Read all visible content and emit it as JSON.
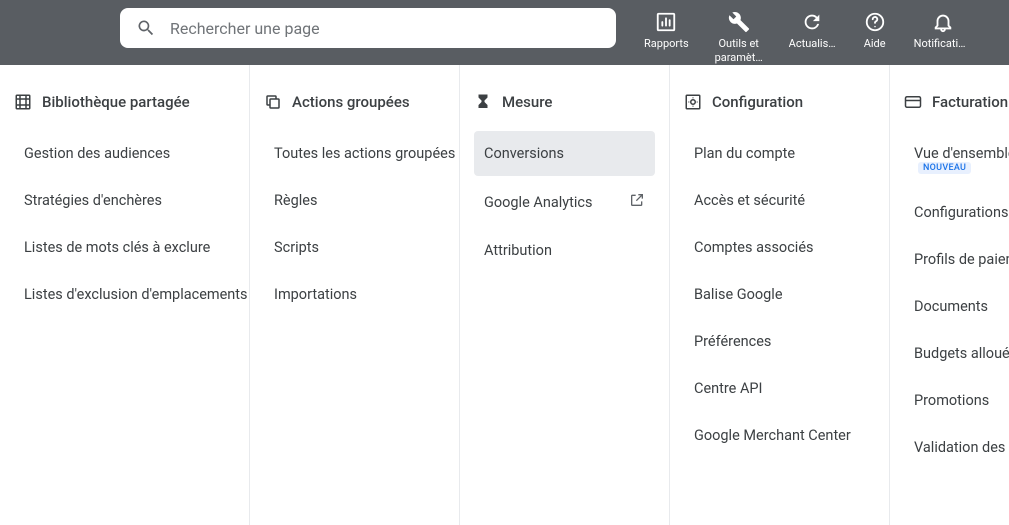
{
  "search": {
    "placeholder": "Rechercher une page"
  },
  "toolbar": {
    "reports": "Rapports",
    "tools": "Outils et paramèt…",
    "refresh": "Actualis…",
    "help": "Aide",
    "notifications": "Notifications"
  },
  "columns": [
    {
      "name": "shared-library",
      "title": "Bibliothèque partagée",
      "items": [
        {
          "label": "Gestion des audiences",
          "name": "audience-management"
        },
        {
          "label": "Stratégies d'enchères",
          "name": "bid-strategies"
        },
        {
          "label": "Listes de mots clés à exclure",
          "name": "negative-keyword-lists"
        },
        {
          "label": "Listes d'exclusion d'emplacements",
          "name": "placement-exclusion-lists"
        }
      ]
    },
    {
      "name": "bulk-actions",
      "title": "Actions groupées",
      "items": [
        {
          "label": "Toutes les actions groupées",
          "name": "all-bulk-actions"
        },
        {
          "label": "Règles",
          "name": "rules"
        },
        {
          "label": "Scripts",
          "name": "scripts"
        },
        {
          "label": "Importations",
          "name": "uploads"
        }
      ]
    },
    {
      "name": "measure",
      "title": "Mesure",
      "items": [
        {
          "label": "Conversions",
          "name": "conversions",
          "highlight": true
        },
        {
          "label": "Google Analytics",
          "name": "google-analytics",
          "external": true
        },
        {
          "label": "Attribution",
          "name": "attribution"
        }
      ]
    },
    {
      "name": "configuration",
      "title": "Configuration",
      "items": [
        {
          "label": "Plan du compte",
          "name": "account-map"
        },
        {
          "label": "Accès et sécurité",
          "name": "access-security"
        },
        {
          "label": "Comptes associés",
          "name": "linked-accounts"
        },
        {
          "label": "Balise Google",
          "name": "google-tag"
        },
        {
          "label": "Préférences",
          "name": "preferences"
        },
        {
          "label": "Centre API",
          "name": "api-center"
        },
        {
          "label": "Google Merchant Center",
          "name": "merchant-center"
        }
      ]
    },
    {
      "name": "billing",
      "title": "Facturation",
      "items": [
        {
          "label": "Vue d'ensemble d",
          "name": "billing-overview",
          "badge": "NOUVEAU"
        },
        {
          "label": "Configurations de",
          "name": "billing-setups"
        },
        {
          "label": "Profils de paieme",
          "name": "payment-profiles"
        },
        {
          "label": "Documents",
          "name": "documents"
        },
        {
          "label": "Budgets alloués a",
          "name": "account-budgets"
        },
        {
          "label": "Promotions",
          "name": "promotions"
        },
        {
          "label": "Validation des an",
          "name": "advertiser-verification"
        }
      ]
    }
  ]
}
